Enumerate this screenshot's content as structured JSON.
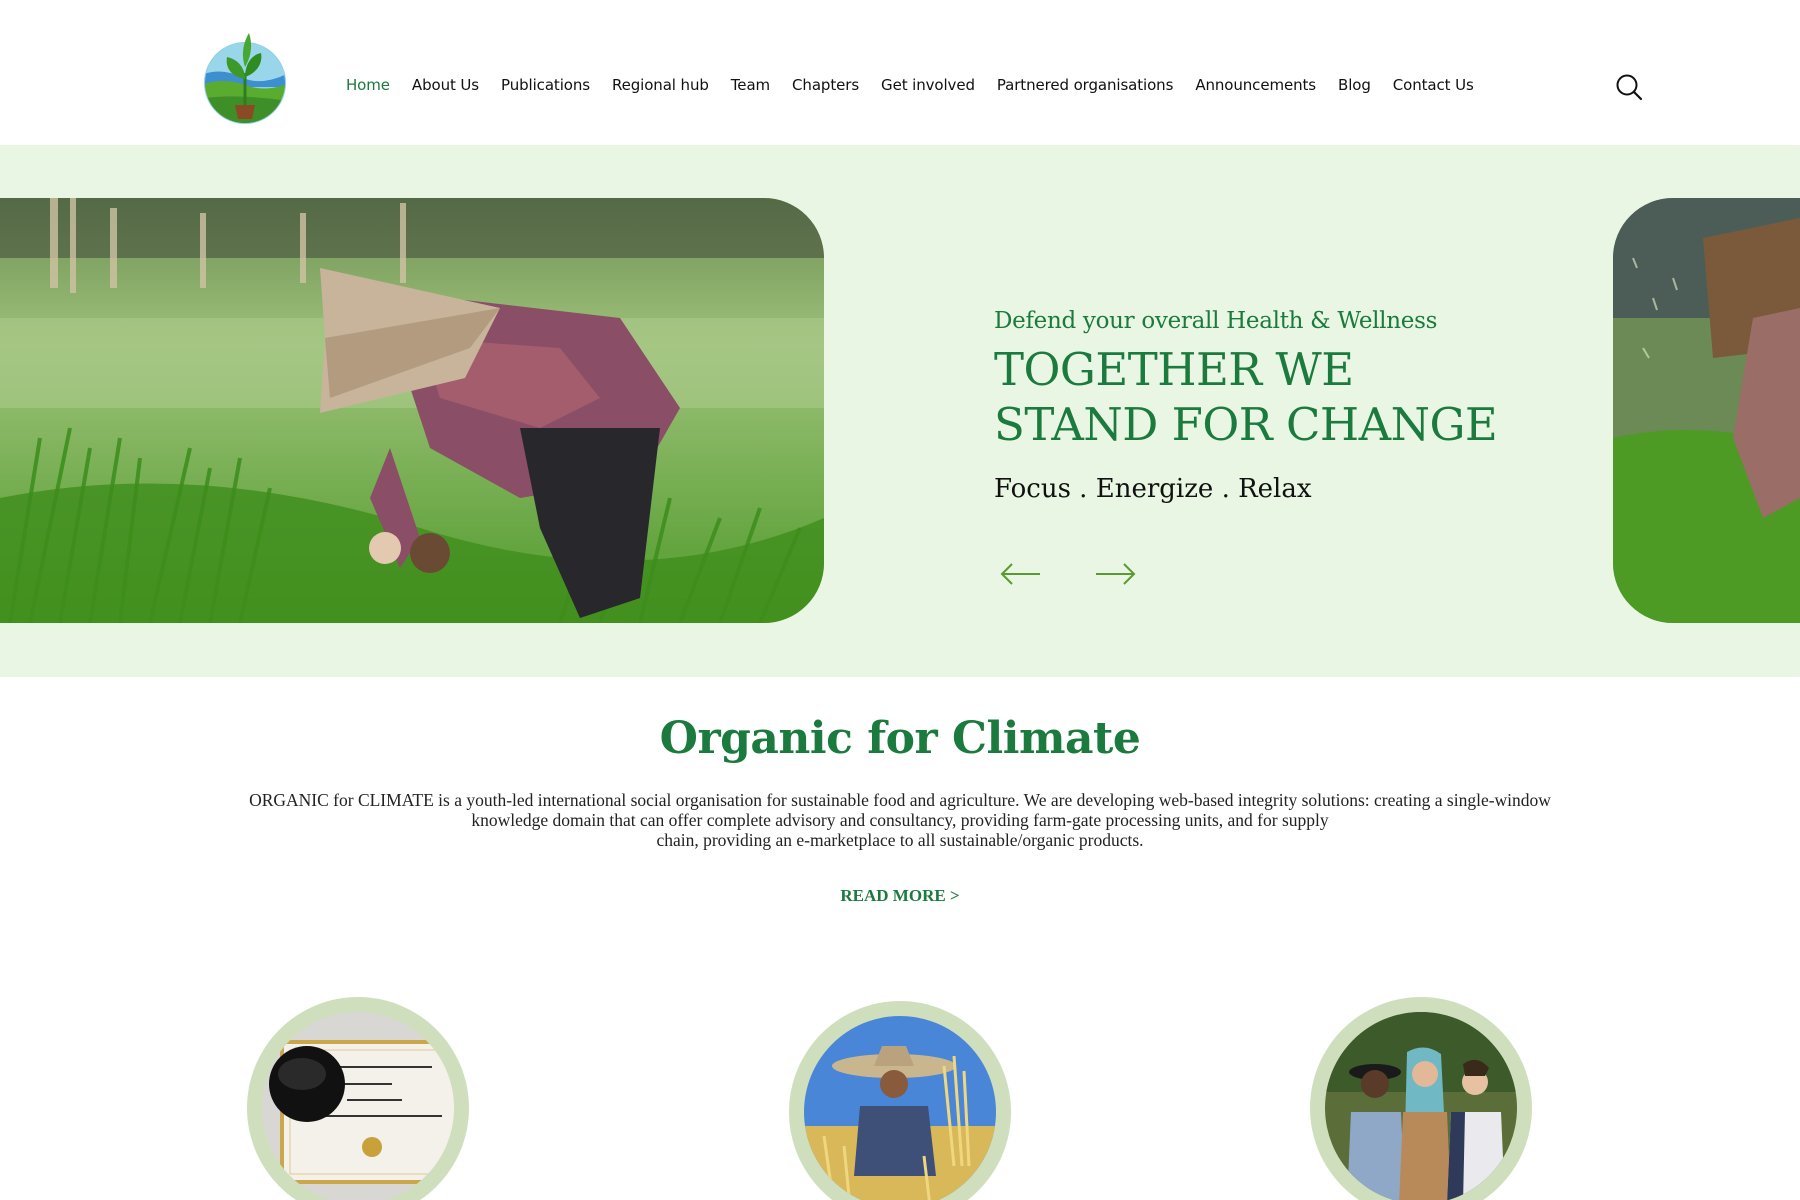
{
  "nav": {
    "items": [
      {
        "label": "Home",
        "active": true
      },
      {
        "label": "About Us",
        "active": false
      },
      {
        "label": "Publications",
        "active": false
      },
      {
        "label": "Regional hub",
        "active": false
      },
      {
        "label": "Team",
        "active": false
      },
      {
        "label": "Chapters",
        "active": false
      },
      {
        "label": "Get involved",
        "active": false
      },
      {
        "label": "Partnered organisations",
        "active": false
      },
      {
        "label": "Announcements",
        "active": false
      },
      {
        "label": "Blog",
        "active": false
      },
      {
        "label": "Contact Us",
        "active": false
      }
    ],
    "search_icon": "search-icon"
  },
  "hero": {
    "subtitle": "Defend your overall Health & Wellness",
    "title_line1": "TOGETHER WE",
    "title_line2": "STAND FOR CHANGE",
    "tagline": "Focus . Energize . Relax",
    "prev_icon": "arrow-left-icon",
    "next_icon": "arrow-right-icon"
  },
  "about": {
    "title": "Organic for Climate",
    "line1": "ORGANIC for CLIMATE is a youth-led international social organisation for sustainable food and agriculture. We are developing web-based integrity solutions: creating a single-window",
    "line2": "knowledge domain that can offer complete advisory and consultancy, providing farm-gate processing units, and for supply",
    "line3": "chain, providing an e-marketplace to all sustainable/organic products.",
    "read_more": "READ MORE >"
  },
  "colors": {
    "brand_green": "#1b7a3d",
    "hero_bg": "#e9f6e3",
    "circle_ring": "#cfdfbd"
  }
}
